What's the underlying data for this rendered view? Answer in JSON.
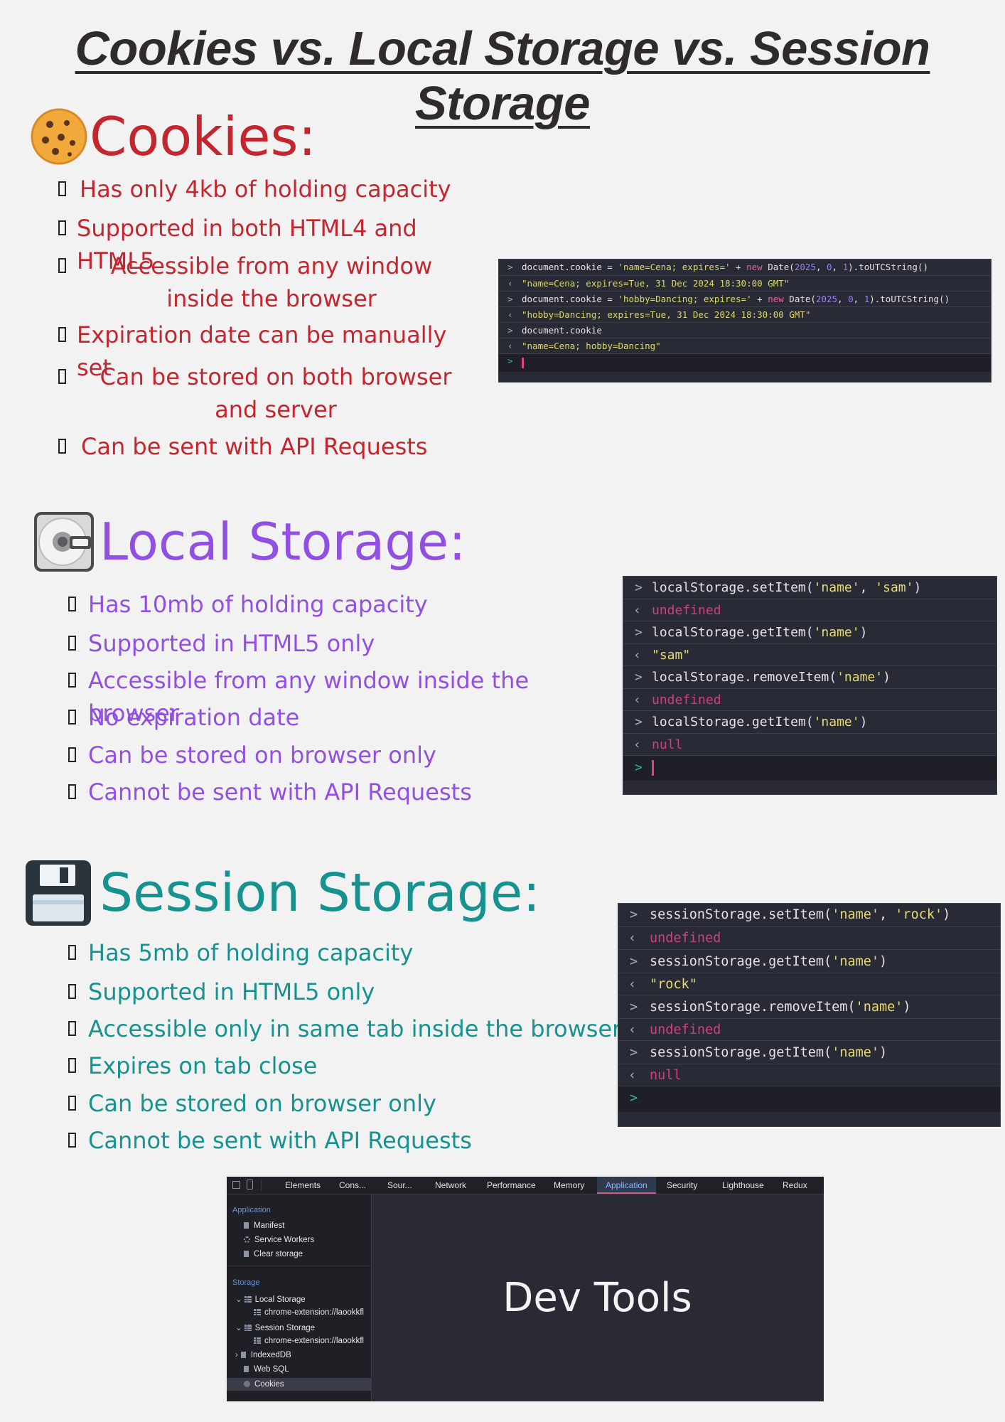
{
  "title": "Cookies vs. Local Storage vs. Session Storage",
  "colors": {
    "cookies": "#c3262f",
    "local": "#9250e3",
    "session": "#16928f",
    "background": "#f2f2f2"
  },
  "cookies": {
    "icon": "cookie-icon",
    "heading": "Cookies:",
    "bullets": [
      "Has only 4kb of holding capacity",
      "Supported in both HTML4 and HTML5",
      "Accessible from any window inside the browser",
      "Expiration date can be manually set",
      "Can be stored on both browser and server",
      "Can be sent with API Requests"
    ],
    "console": {
      "lines": [
        {
          "type": "in",
          "text": "document.cookie = 'name=Cena; expires=' + new Date(2025, 0, 1).toUTCString()"
        },
        {
          "type": "out",
          "text": "\"name=Cena; expires=Tue, 31 Dec 2024 18:30:00 GMT\""
        },
        {
          "type": "in",
          "text": "document.cookie = 'hobby=Dancing; expires=' + new Date(2025, 0, 1).toUTCString()"
        },
        {
          "type": "out",
          "text": "\"hobby=Dancing; expires=Tue, 31 Dec 2024 18:30:00 GMT\""
        },
        {
          "type": "in",
          "text": "document.cookie"
        },
        {
          "type": "out",
          "text": "\"name=Cena; hobby=Dancing\""
        }
      ]
    }
  },
  "local": {
    "icon": "disc-drive-icon",
    "heading": "Local Storage:",
    "bullets": [
      "Has 10mb of holding capacity",
      "Supported in HTML5 only",
      "Accessible from any window inside the browser",
      "No expiration date",
      "Can be stored on browser only",
      "Cannot be sent with API Requests"
    ],
    "console": {
      "lines": [
        {
          "type": "in",
          "text": "localStorage.setItem('name', 'sam')"
        },
        {
          "type": "out",
          "text": "undefined"
        },
        {
          "type": "in",
          "text": "localStorage.getItem('name')"
        },
        {
          "type": "out",
          "text": "\"sam\""
        },
        {
          "type": "in",
          "text": "localStorage.removeItem('name')"
        },
        {
          "type": "out",
          "text": "undefined"
        },
        {
          "type": "in",
          "text": "localStorage.getItem('name')"
        },
        {
          "type": "out",
          "text": "null"
        }
      ]
    }
  },
  "session": {
    "icon": "floppy-disk-icon",
    "heading": "Session Storage:",
    "bullets": [
      "Has 5mb of holding capacity",
      "Supported in HTML5 only",
      "Accessible only in same tab inside the browser",
      "Expires on tab close",
      "Can be stored on browser only",
      "Cannot be sent with API Requests"
    ],
    "console": {
      "lines": [
        {
          "type": "in",
          "text": "sessionStorage.setItem('name', 'rock')"
        },
        {
          "type": "out",
          "text": "undefined"
        },
        {
          "type": "in",
          "text": "sessionStorage.getItem('name')"
        },
        {
          "type": "out",
          "text": "\"rock\""
        },
        {
          "type": "in",
          "text": "sessionStorage.removeItem('name')"
        },
        {
          "type": "out",
          "text": "undefined"
        },
        {
          "type": "in",
          "text": "sessionStorage.getItem('name')"
        },
        {
          "type": "out",
          "text": "null"
        }
      ]
    }
  },
  "devtools": {
    "tabs": [
      "Elements",
      "Cons...",
      "Sour...",
      "Network",
      "Performance",
      "Memory",
      "Application",
      "Security",
      "Lighthouse",
      "Redux"
    ],
    "active_tab": "Application",
    "sidebar": {
      "application_label": "Application",
      "application_items": [
        "Manifest",
        "Service Workers",
        "Clear storage"
      ],
      "storage_label": "Storage",
      "storage_items": [
        "Local Storage",
        "chrome-extension://laookkfl",
        "Session Storage",
        "chrome-extension://laookkfl",
        "IndexedDB",
        "Web SQL",
        "Cookies"
      ]
    },
    "main_label": "Dev Tools"
  }
}
